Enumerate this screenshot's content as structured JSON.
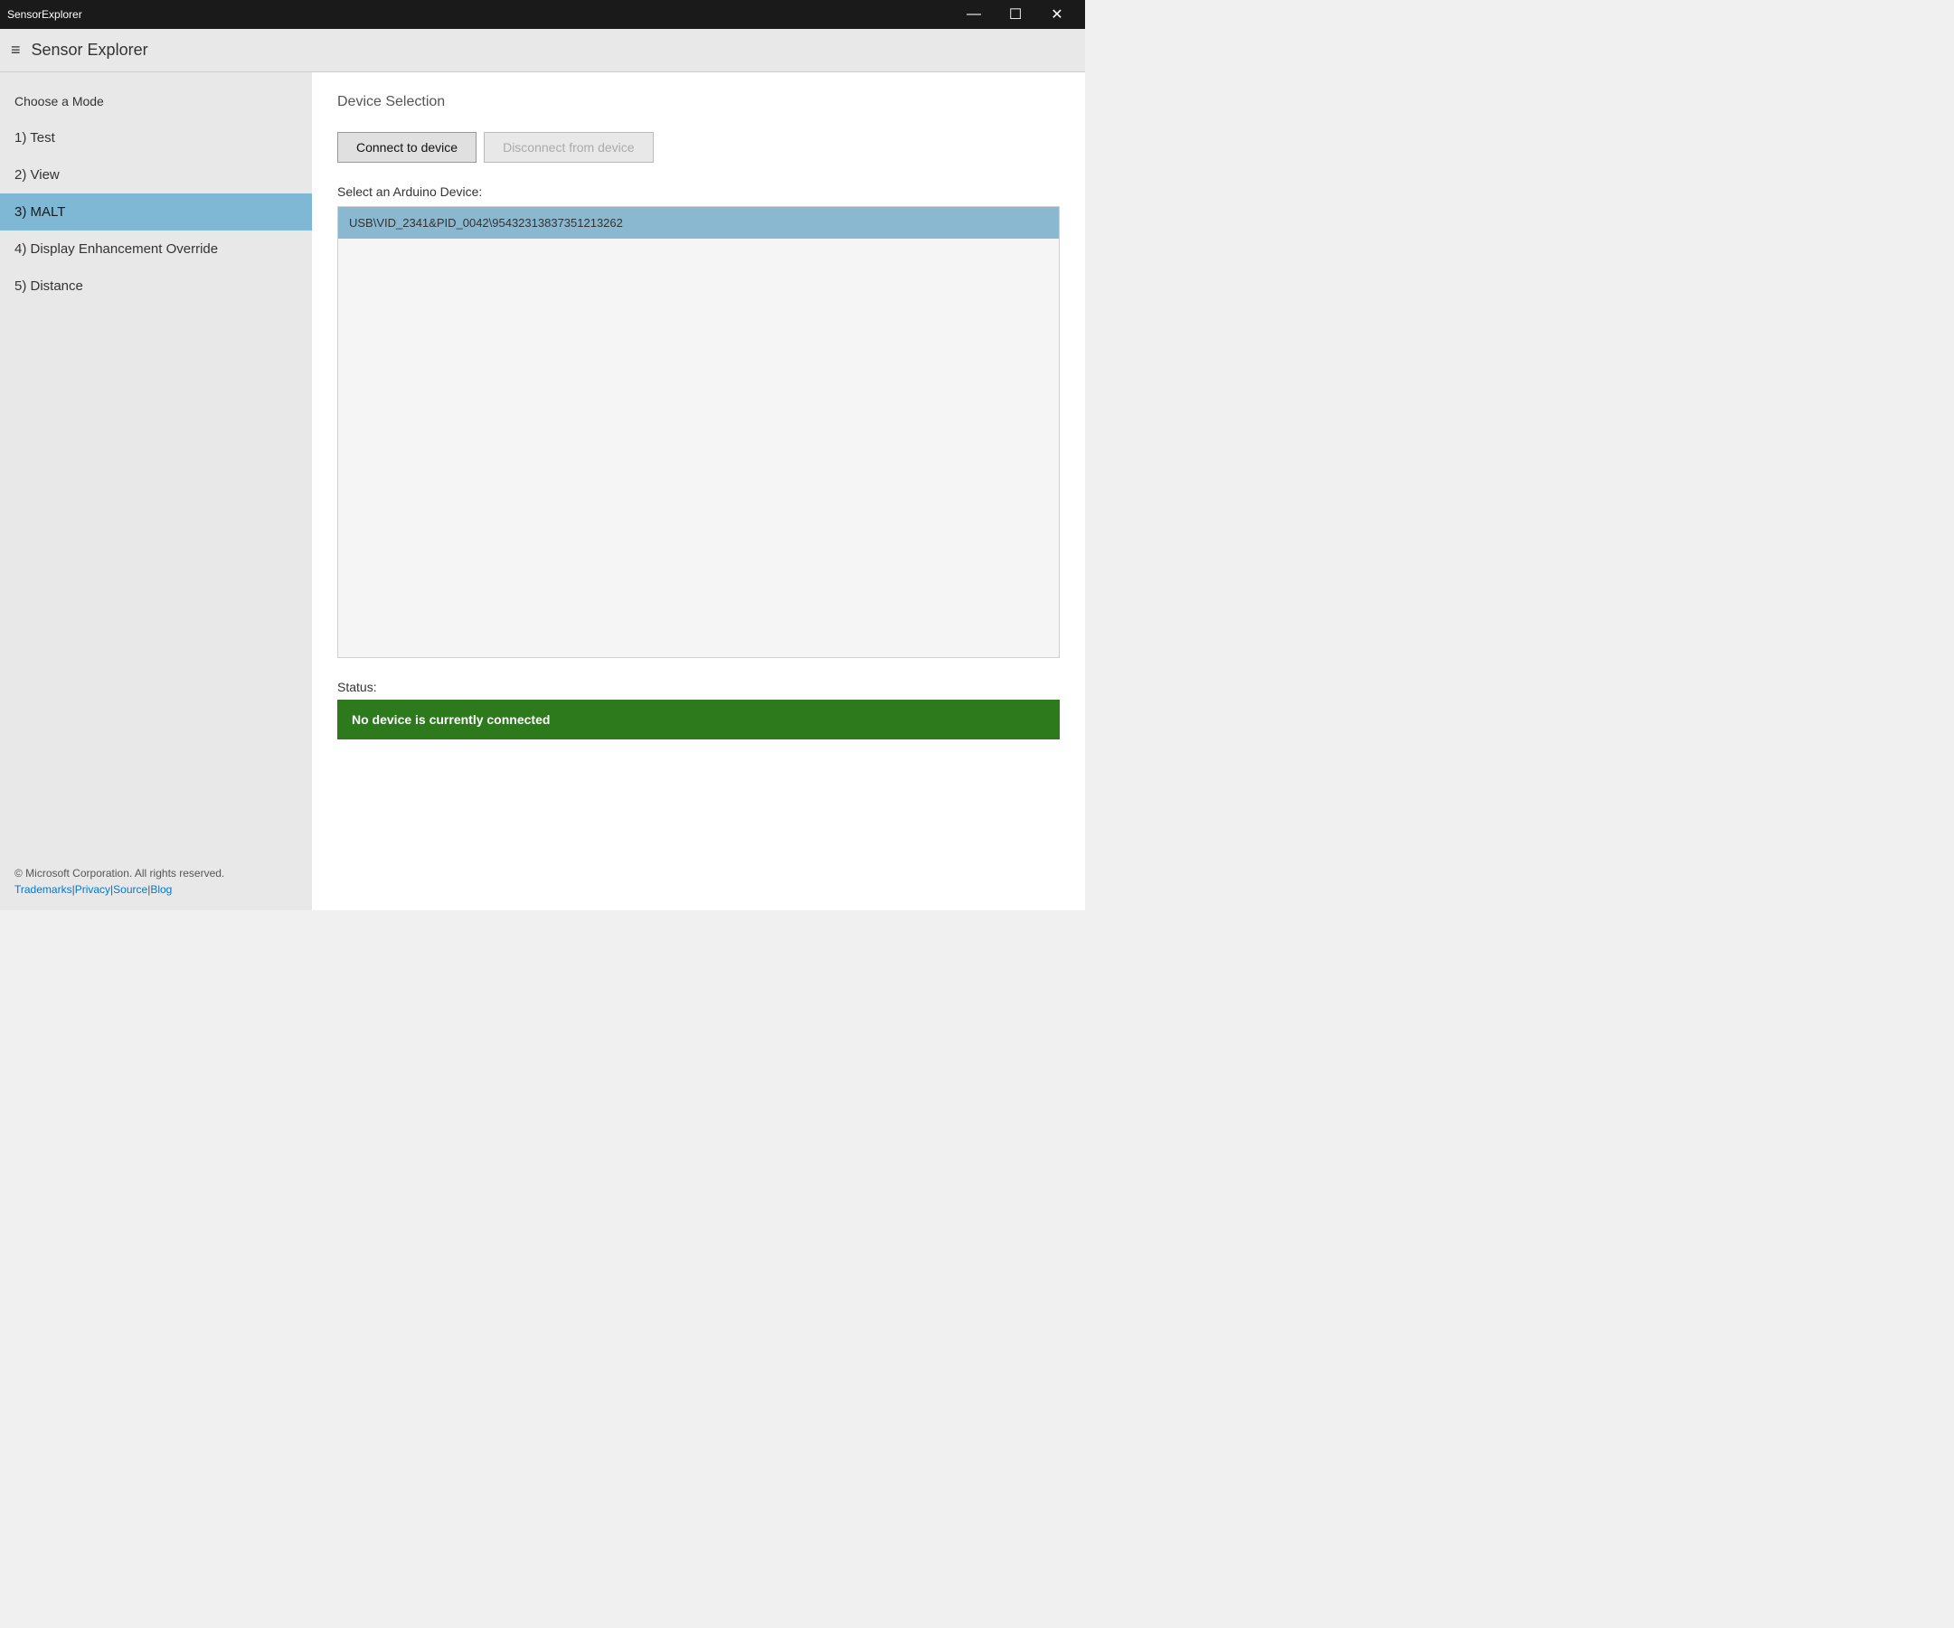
{
  "window": {
    "title": "SensorExplorer",
    "min_label": "—",
    "restore_label": "☐",
    "close_label": "✕"
  },
  "header": {
    "hamburger": "≡",
    "app_title": "Sensor Explorer"
  },
  "sidebar": {
    "heading": "Choose a Mode",
    "items": [
      {
        "id": "test",
        "label": "1) Test",
        "active": false
      },
      {
        "id": "view",
        "label": "2) View",
        "active": false
      },
      {
        "id": "malt",
        "label": "3) MALT",
        "active": true
      },
      {
        "id": "display",
        "label": "4) Display Enhancement Override",
        "active": false
      },
      {
        "id": "distance",
        "label": "5) Distance",
        "active": false
      }
    ],
    "footer": {
      "copyright": "© Microsoft Corporation. All rights reserved.",
      "links": [
        {
          "label": "Trademarks",
          "href": "#"
        },
        {
          "label": "Privacy",
          "href": "#"
        },
        {
          "label": "Source",
          "href": "#"
        },
        {
          "label": "Blog",
          "href": "#"
        }
      ]
    }
  },
  "content": {
    "section_title": "Device Selection",
    "connect_btn": "Connect to device",
    "disconnect_btn": "Disconnect from device",
    "device_select_label": "Select an Arduino Device:",
    "device_items": [
      {
        "id": "device1",
        "label": "USB\\VID_2341&PID_0042\\95432313837351213262",
        "selected": true
      }
    ],
    "status_label": "Status:",
    "status_text": "No device is currently connected"
  }
}
